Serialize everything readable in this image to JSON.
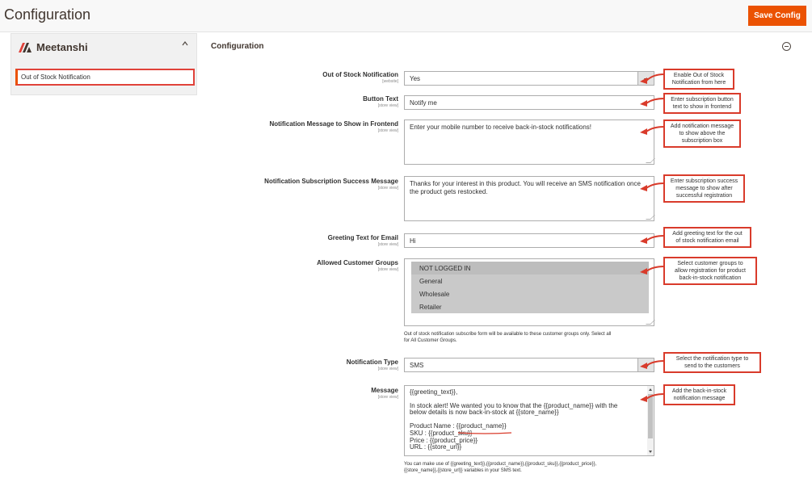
{
  "header": {
    "title": "Configuration",
    "save_label": "Save Config"
  },
  "sidebar": {
    "brand": "Meetanshi",
    "item": "Out of Stock Notification"
  },
  "section": {
    "title": "Configuration"
  },
  "fields": {
    "out_of_stock": {
      "label": "Out of Stock Notification",
      "scope": "[website]",
      "value": "Yes"
    },
    "button_text": {
      "label": "Button Text",
      "scope": "[store view]",
      "value": "Notify me"
    },
    "notif_msg": {
      "label": "Notification Message to Show in Frontend",
      "scope": "[store view]",
      "value": "Enter your mobile number to receive back-in-stock notifications!"
    },
    "success_msg": {
      "label": "Notification Subscription Success Message",
      "scope": "[store view]",
      "value_line1": "Thanks for your interest in this product. You will receive an SMS notification once",
      "value_line2": "the product gets restocked."
    },
    "greeting": {
      "label": "Greeting Text for Email",
      "scope": "[store view]",
      "value": "Hi"
    },
    "groups": {
      "label": "Allowed Customer Groups",
      "scope": "[store view]",
      "options": [
        "NOT LOGGED IN",
        "General",
        "Wholesale",
        "Retailer"
      ],
      "note_line1": "Out of stock notification subscribe form will be available to these customer groups only. Select all",
      "note_line2": "for All Customer Groups."
    },
    "notif_type": {
      "label": "Notification Type",
      "scope": "[store view]",
      "value": "SMS"
    },
    "message": {
      "label": "Message",
      "scope": "[store view]",
      "lines": [
        "{{greeting_text}},",
        "",
        "In stock alert! We wanted you to know that the {{product_name}} with the",
        "below details is now back-in-stock at {{store_name}}",
        "",
        "Product Name : {{product_name}}",
        "SKU : {{product_sku}}",
        "Price : {{product_price}}",
        "URL : {{store_url}}"
      ],
      "note_line1": "You can make use of {{greeting_text}},{{product_name}},{{product_sku}},{{product_price}},",
      "note_line2": "{{store_name}},{{store_url}} variables in your SMS text."
    }
  },
  "callouts": {
    "c1": [
      "Enable Out of Stock",
      "Notification from here"
    ],
    "c2": [
      "Enter subscription button",
      "text to show in frontend"
    ],
    "c3": [
      "Add notification message",
      "to show above the",
      "subscription box"
    ],
    "c4": [
      "Enter subscription success",
      "message to show after",
      "successful registration"
    ],
    "c5": [
      "Add greeting text for the out",
      "of stock notification email"
    ],
    "c6": [
      "Select customer groups to",
      "allow registration for product",
      "back-in-stock notification"
    ],
    "c7": [
      "Select the notification type to",
      "send to the customers"
    ],
    "c8": [
      "Add the back-in-stock",
      "notification message"
    ]
  },
  "colors": {
    "accent": "#eb5202",
    "callout_border": "#d93b2b"
  }
}
